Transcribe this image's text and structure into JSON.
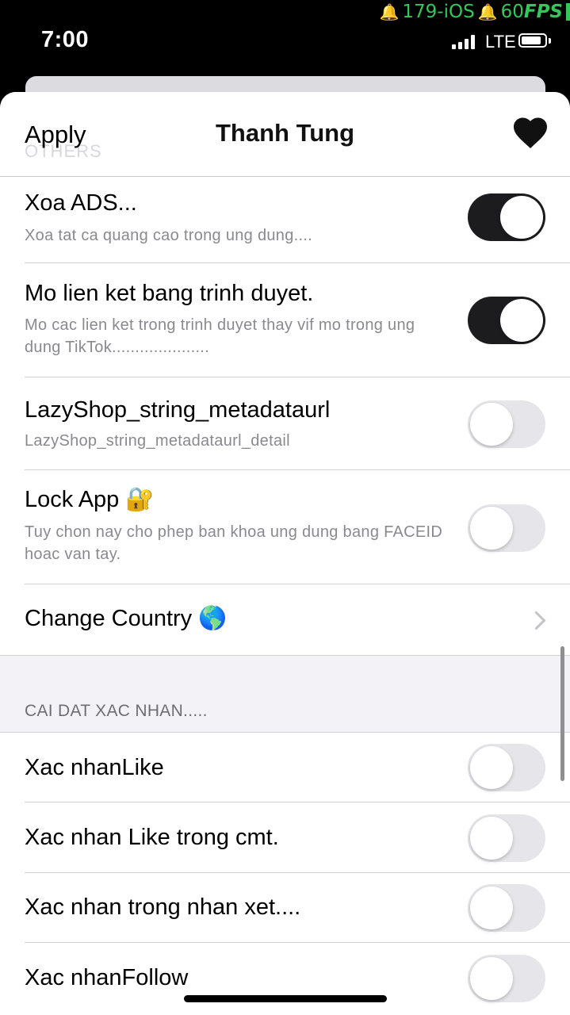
{
  "status_bar": {
    "time": "7:00",
    "network": "LTE",
    "overlay_bell": "🔔",
    "overlay_device": "179-iOS",
    "overlay_fps_value": "60",
    "overlay_fps_unit": "FPS"
  },
  "nav": {
    "apply_label": "Apply",
    "title": "Thanh Tung",
    "ghost_header": "OTHERS"
  },
  "settings": [
    {
      "title": "Xoa ADS...",
      "subtitle": "Xoa tat ca quang cao trong ung dung....",
      "on": true
    },
    {
      "title": "Mo lien ket bang trinh duyet.",
      "subtitle": "Mo cac lien ket trong trinh duyet thay vif mo trong ung dung TikTok.....................",
      "on": true
    },
    {
      "title": "LazyShop_string_metadataurl",
      "subtitle": "LazyShop_string_metadataurl_detail",
      "on": false
    },
    {
      "title": "Lock App 🔐",
      "subtitle": "Tuy chon nay cho phep ban khoa ung dung bang FACEID hoac van tay.",
      "on": false
    }
  ],
  "change_country": {
    "label": "Change Country 🌎"
  },
  "confirm_section": {
    "header": "CAI DAT XAC NHAN.....",
    "items": [
      {
        "title": "Xac nhanLike",
        "on": false
      },
      {
        "title": "Xac nhan Like trong cmt.",
        "on": false
      },
      {
        "title": "Xac nhan trong nhan xet....",
        "on": false
      },
      {
        "title": "Xac nhanFollow",
        "on": false
      }
    ]
  }
}
